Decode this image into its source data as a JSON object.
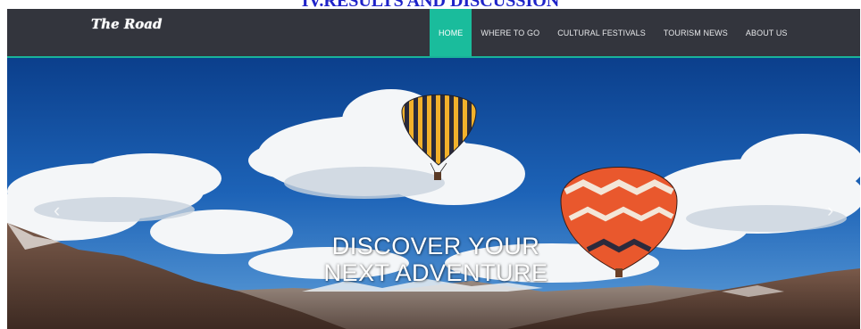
{
  "document_heading": "IV.RESULTS AND DISCUSSION",
  "site": {
    "brand": "The Road",
    "accent_color": "#1abc9c",
    "nav": [
      {
        "label": "HOME",
        "active": true
      },
      {
        "label": "WHERE TO GO",
        "active": false
      },
      {
        "label": "CULTURAL FESTIVALS",
        "active": false
      },
      {
        "label": "TOURISM NEWS",
        "active": false
      },
      {
        "label": "ABOUT US",
        "active": false
      }
    ]
  },
  "hero": {
    "line1": "DISCOVER YOUR",
    "line2": "NEXT ADVENTURE",
    "prev_icon": "chevron-left-icon",
    "next_icon": "chevron-right-icon",
    "prev_glyph": "‹",
    "next_glyph": "›"
  }
}
